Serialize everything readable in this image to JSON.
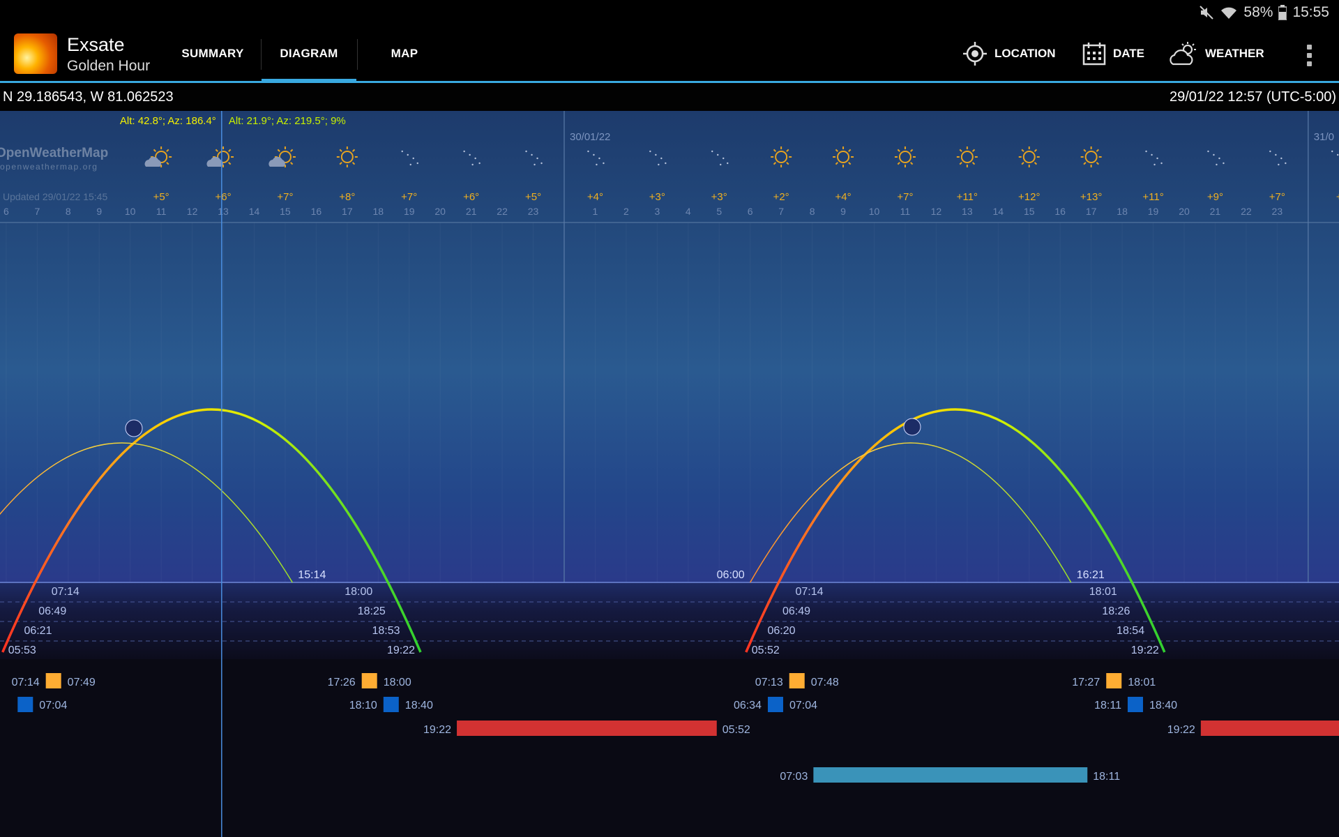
{
  "status_bar": {
    "battery": "58%",
    "time": "15:55",
    "icons": [
      "mute-icon",
      "wifi-icon",
      "battery-icon"
    ]
  },
  "app": {
    "title": "Exsate",
    "subtitle": "Golden Hour"
  },
  "tabs": [
    {
      "label": "SUMMARY",
      "active": false
    },
    {
      "label": "DIAGRAM",
      "active": true
    },
    {
      "label": "MAP",
      "active": false
    }
  ],
  "actions": [
    {
      "label": "LOCATION",
      "icon": "location-crosshair-icon"
    },
    {
      "label": "DATE",
      "icon": "calendar-icon"
    },
    {
      "label": "WEATHER",
      "icon": "cloud-sun-icon"
    }
  ],
  "coordinates": "N 29.186543, W 81.062523",
  "datetime": "29/01/22 12:57 (UTC-5:00)",
  "cursor": {
    "sun_reading": "Alt: 42.8°; Az: 186.4°",
    "moon_reading": "Alt: 21.9°; Az: 219.5°; 9%"
  },
  "weather": {
    "provider": "OpenWeatherMap",
    "provider_url": "openweathermap.org",
    "updated": "Updated 29/01/22 15:45",
    "dates": [
      "30/01/22",
      "31/0"
    ],
    "hour_labels": [
      {
        "h": 6,
        "label": "6"
      },
      {
        "h": 7,
        "label": "7"
      },
      {
        "h": 8,
        "label": "8"
      },
      {
        "h": 9,
        "label": "9"
      },
      {
        "h": 10,
        "label": "10"
      },
      {
        "h": 11,
        "label": "11"
      },
      {
        "h": 12,
        "label": "12"
      },
      {
        "h": 13,
        "label": "13"
      },
      {
        "h": 14,
        "label": "14"
      },
      {
        "h": 15,
        "label": "15"
      },
      {
        "h": 16,
        "label": "16"
      },
      {
        "h": 17,
        "label": "17"
      },
      {
        "h": 18,
        "label": "18"
      },
      {
        "h": 19,
        "label": "19"
      },
      {
        "h": 20,
        "label": "20"
      },
      {
        "h": 21,
        "label": "21"
      },
      {
        "h": 22,
        "label": "22"
      },
      {
        "h": 23,
        "label": "23"
      },
      {
        "h": 25,
        "label": "1"
      },
      {
        "h": 26,
        "label": "2"
      },
      {
        "h": 27,
        "label": "3"
      },
      {
        "h": 28,
        "label": "4"
      },
      {
        "h": 29,
        "label": "5"
      },
      {
        "h": 30,
        "label": "6"
      },
      {
        "h": 31,
        "label": "7"
      },
      {
        "h": 32,
        "label": "8"
      },
      {
        "h": 33,
        "label": "9"
      },
      {
        "h": 34,
        "label": "10"
      },
      {
        "h": 35,
        "label": "11"
      },
      {
        "h": 36,
        "label": "12"
      },
      {
        "h": 37,
        "label": "13"
      },
      {
        "h": 38,
        "label": "14"
      },
      {
        "h": 39,
        "label": "15"
      },
      {
        "h": 40,
        "label": "16"
      },
      {
        "h": 41,
        "label": "17"
      },
      {
        "h": 42,
        "label": "18"
      },
      {
        "h": 43,
        "label": "19"
      },
      {
        "h": 44,
        "label": "20"
      },
      {
        "h": 45,
        "label": "21"
      },
      {
        "h": 46,
        "label": "22"
      },
      {
        "h": 47,
        "label": "23"
      }
    ],
    "forecast": [
      {
        "h": 11,
        "icon": "partly-cloudy",
        "temp": "+5°"
      },
      {
        "h": 13,
        "icon": "partly-cloudy",
        "temp": "+6°"
      },
      {
        "h": 15,
        "icon": "partly-cloudy",
        "temp": "+7°"
      },
      {
        "h": 17,
        "icon": "sunny",
        "temp": "+8°"
      },
      {
        "h": 19,
        "icon": "clear-night",
        "temp": "+7°"
      },
      {
        "h": 21,
        "icon": "clear-night",
        "temp": "+6°"
      },
      {
        "h": 23,
        "icon": "clear-night",
        "temp": "+5°"
      },
      {
        "h": 25,
        "icon": "clear-night",
        "temp": "+4°"
      },
      {
        "h": 27,
        "icon": "clear-night",
        "temp": "+3°"
      },
      {
        "h": 29,
        "icon": "clear-night",
        "temp": "+3°"
      },
      {
        "h": 31,
        "icon": "sunny",
        "temp": "+2°"
      },
      {
        "h": 33,
        "icon": "sunny",
        "temp": "+4°"
      },
      {
        "h": 35,
        "icon": "sunny",
        "temp": "+7°"
      },
      {
        "h": 37,
        "icon": "sunny",
        "temp": "+11°"
      },
      {
        "h": 39,
        "icon": "sunny",
        "temp": "+12°"
      },
      {
        "h": 41,
        "icon": "sunny",
        "temp": "+13°"
      },
      {
        "h": 43,
        "icon": "clear-night",
        "temp": "+11°"
      },
      {
        "h": 45,
        "icon": "clear-night",
        "temp": "+9°"
      },
      {
        "h": 47,
        "icon": "clear-night",
        "temp": "+7°"
      },
      {
        "h": 49,
        "icon": "clear-night",
        "temp": "+"
      }
    ]
  },
  "days": [
    {
      "sun_rise_set": [
        "07:14",
        "18:00"
      ],
      "civil": [
        "06:49",
        "18:25"
      ],
      "nautical": [
        "06:21",
        "18:53"
      ],
      "astronomical": [
        "05:53",
        "19:22"
      ],
      "golden_morning": [
        "07:14",
        "07:49"
      ],
      "golden_evening": [
        "17:26",
        "18:00"
      ],
      "blue_morning": [
        "",
        "07:04"
      ],
      "blue_evening": [
        "18:10",
        "18:40"
      ],
      "moon_rise_set": [
        "",
        "15:14"
      ],
      "night": [
        "19:22",
        "05:52"
      ],
      "moon_visible": [
        "07:03",
        "18:11"
      ]
    },
    {
      "sun_rise_set": [
        "07:14",
        "18:01"
      ],
      "civil": [
        "06:49",
        "18:26"
      ],
      "nautical": [
        "06:20",
        "18:54"
      ],
      "astronomical": [
        "05:52",
        "19:22"
      ],
      "golden_morning": [
        "07:13",
        "07:48"
      ],
      "golden_evening": [
        "17:27",
        "18:01"
      ],
      "blue_morning": [
        "06:34",
        "07:04"
      ],
      "blue_evening": [
        "18:11",
        "18:40"
      ],
      "moon_rise_set": [
        "06:00",
        "16:21"
      ],
      "night": [
        "19:22",
        ""
      ]
    }
  ],
  "colors": {
    "accent": "#39a9e0",
    "golden": "#ffad33",
    "blue_hour": "#0b62c8",
    "night_bar": "#d23232",
    "moon_bar": "#3a93b9",
    "sun_high": "#ffe400",
    "sun_low": "#ff3322",
    "label": "#9fb6e0"
  }
}
